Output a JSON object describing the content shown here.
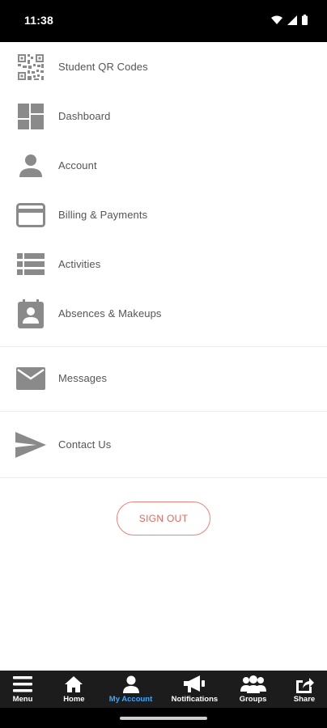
{
  "status_bar": {
    "time": "11:38",
    "icons": [
      "wifi-icon",
      "signal-icon",
      "battery-icon"
    ]
  },
  "menu": {
    "groups": [
      [
        {
          "label": "Student QR Codes",
          "icon": "qr-code-icon"
        },
        {
          "label": "Dashboard",
          "icon": "dashboard-icon"
        },
        {
          "label": "Account",
          "icon": "person-icon"
        },
        {
          "label": "Billing & Payments",
          "icon": "credit-card-icon"
        },
        {
          "label": "Activities",
          "icon": "list-icon"
        },
        {
          "label": "Absences & Makeups",
          "icon": "contact-badge-icon"
        }
      ],
      [
        {
          "label": "Messages",
          "icon": "envelope-icon"
        }
      ],
      [
        {
          "label": "Contact Us",
          "icon": "send-icon"
        }
      ]
    ]
  },
  "sign_out": {
    "label": "SIGN OUT"
  },
  "tabbar": {
    "tabs": [
      {
        "label": "Menu",
        "icon": "hamburger-icon",
        "active": false
      },
      {
        "label": "Home",
        "icon": "home-icon",
        "active": false
      },
      {
        "label": "My Account",
        "icon": "account-icon",
        "active": true
      },
      {
        "label": "Notifications",
        "icon": "megaphone-icon",
        "active": false
      },
      {
        "label": "Groups",
        "icon": "groups-icon",
        "active": false
      },
      {
        "label": "Share",
        "icon": "share-icon",
        "active": false
      }
    ]
  },
  "colors": {
    "icon_gray": "#8a8a8a",
    "accent_signout": "#e8645a",
    "tab_active": "#3ea6ff",
    "tabbar_bg": "#1c1c1c"
  }
}
